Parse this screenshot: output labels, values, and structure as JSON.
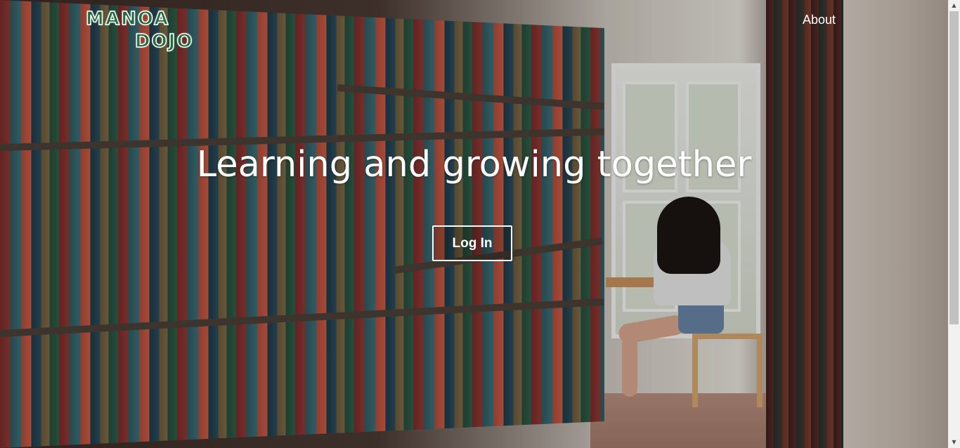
{
  "logo": {
    "line1": "MANOA",
    "line2": "DOJO"
  },
  "nav": {
    "about_label": "About"
  },
  "hero": {
    "title": "Learning and growing together",
    "login_label": "Log In"
  },
  "scrollbar": {
    "up_arrow": "▲",
    "down_arrow": "▼"
  }
}
